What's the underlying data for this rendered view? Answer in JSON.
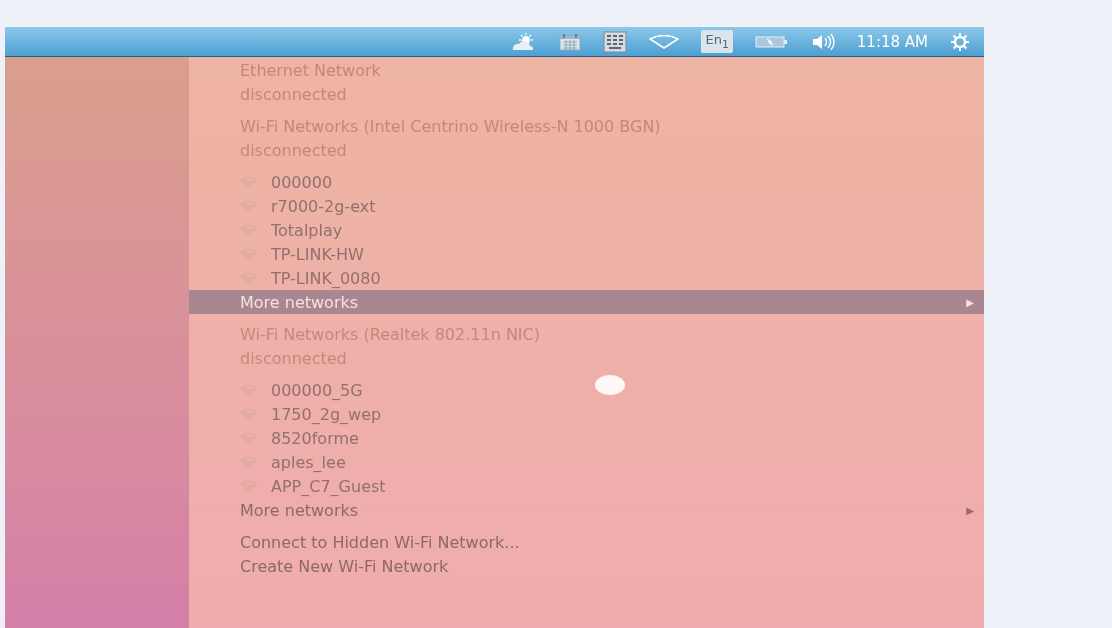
{
  "top_panel": {
    "indicators": [
      {
        "kind": "weather"
      },
      {
        "kind": "calendar"
      },
      {
        "kind": "keyboard"
      },
      {
        "kind": "wifi"
      },
      {
        "kind": "language",
        "label": "En$_{1}$"
      },
      {
        "kind": "battery"
      },
      {
        "kind": "volume"
      },
      {
        "kind": "clock",
        "label": "11:18 AM"
      },
      {
        "kind": "gear"
      }
    ]
  },
  "network_menu": {
    "items": [
      {
        "kind": "header",
        "label": "Ethernet Network",
        "disabled": true
      },
      {
        "kind": "header",
        "label": "disconnected",
        "disabled": true
      },
      {
        "kind": "separator"
      },
      {
        "kind": "header",
        "label": "Wi-Fi Networks (Intel Centrino Wireless-N 1000 BGN)",
        "disabled": true
      },
      {
        "kind": "header",
        "label": "disconnected",
        "disabled": true
      },
      {
        "kind": "separator"
      },
      {
        "kind": "network",
        "label": "000000"
      },
      {
        "kind": "network",
        "label": "r7000-2g-ext"
      },
      {
        "kind": "network",
        "label": "Totalplay"
      },
      {
        "kind": "network",
        "label": "TP-LINK-HW"
      },
      {
        "kind": "network",
        "label": "TP-LINK_0080"
      },
      {
        "kind": "submenu",
        "label": "More networks",
        "arrow": "▶",
        "selected": true
      },
      {
        "kind": "separator"
      },
      {
        "kind": "header",
        "label": "Wi-Fi Networks (Realtek 802.11n NIC)",
        "disabled": true
      },
      {
        "kind": "header",
        "label": "disconnected",
        "disabled": true
      },
      {
        "kind": "separator"
      },
      {
        "kind": "network",
        "label": "000000_5G"
      },
      {
        "kind": "network",
        "label": "1750_2g_wep"
      },
      {
        "kind": "network",
        "label": "8520forme"
      },
      {
        "kind": "network",
        "label": "aples_lee"
      },
      {
        "kind": "network",
        "label": "APP_C7_Guest"
      },
      {
        "kind": "submenu",
        "label": "More networks",
        "arrow": "▶",
        "selected": false
      },
      {
        "kind": "separator"
      },
      {
        "kind": "action",
        "label": "Connect to Hidden Wi-Fi Network..."
      },
      {
        "kind": "action",
        "label": "Create New Wi-Fi Network"
      }
    ]
  }
}
